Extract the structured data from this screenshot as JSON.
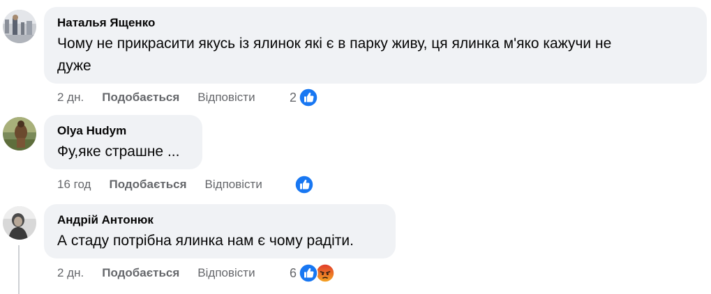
{
  "comments": [
    {
      "author": "Наталья Ященко",
      "text_line1": "Чому не прикрасити якусь із ялинок які є в парку живу, ця ялинка м'яко кажучи не",
      "text_line2": "дуже",
      "time": "2 дн.",
      "like_label": "Подобається",
      "reply_label": "Відповісти",
      "reaction_count": "2",
      "reactions": [
        "like-icon"
      ]
    },
    {
      "author": "Olya Hudym",
      "text_line1": "Фу,яке страшне ...",
      "time": "16 год",
      "like_label": "Подобається",
      "reply_label": "Відповісти",
      "reaction_count": "",
      "reactions": [
        "like-icon"
      ]
    },
    {
      "author": "Андрій Антонюк",
      "text_line1": "А стаду потрібна ялинка нам є чому радіти.",
      "time": "2 дн.",
      "like_label": "Подобається",
      "reply_label": "Відповісти",
      "reaction_count": "6",
      "reactions": [
        "like-icon",
        "angry-icon"
      ]
    }
  ],
  "colors": {
    "bubble": "#f0f2f5",
    "meta_text": "#65676b",
    "like_blue": "#1877f2",
    "angry_orange": "#e9710f"
  }
}
